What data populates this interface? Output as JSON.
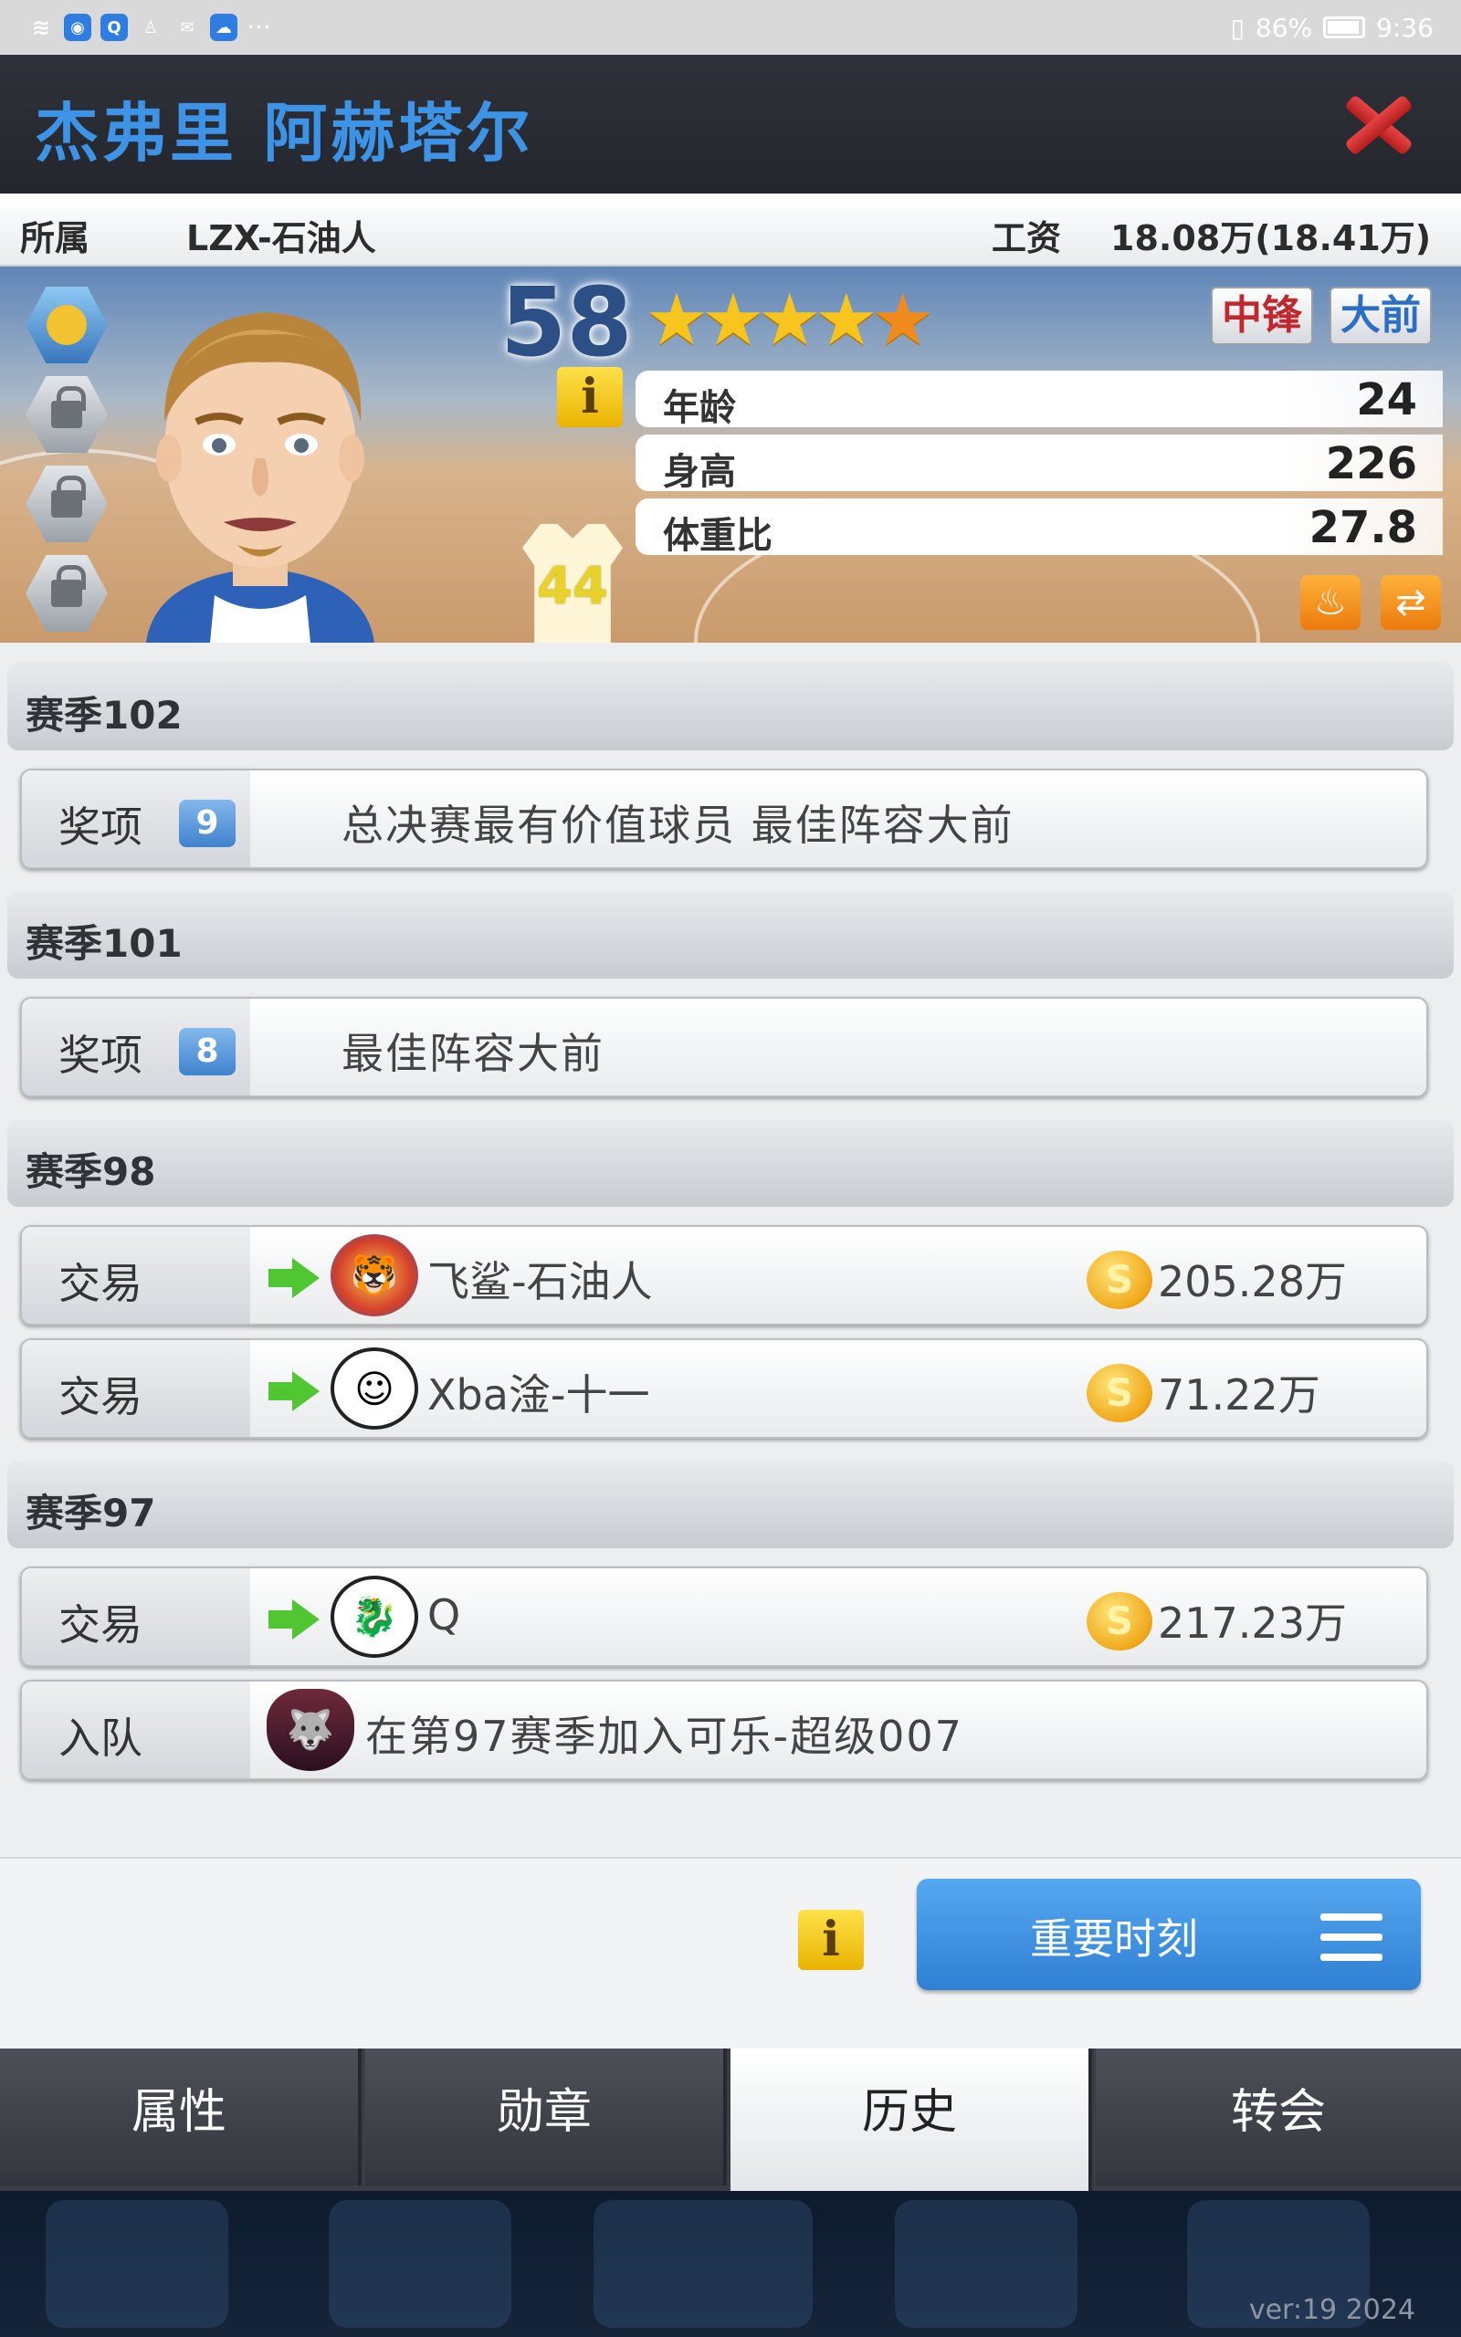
{
  "status_bar": {
    "icons": [
      "wifi-icon",
      "browser-icon",
      "search-app-icon",
      "qq-icon",
      "message-icon",
      "cloud-icon"
    ],
    "more": "···",
    "battery": "86%",
    "time": "9:36"
  },
  "header": {
    "title": "杰弗里 阿赫塔尔"
  },
  "info_strip": {
    "team_label": "所属",
    "team_value": "LZX-石油人",
    "salary_label": "工资",
    "salary_value": "18.08万(18.41万)"
  },
  "player": {
    "rating": "58",
    "stars_full": 4,
    "stars_half": 1,
    "positions": [
      "中锋",
      "大前"
    ],
    "jersey_number": "44",
    "stats": [
      {
        "label": "年龄",
        "value": "24"
      },
      {
        "label": "身高",
        "value": "226"
      },
      {
        "label": "体重比",
        "value": "27.8"
      }
    ],
    "info_button": "i"
  },
  "history": [
    {
      "season": "赛季102",
      "events": [
        {
          "type": "奖项",
          "count": "9",
          "desc": "总决赛最有价值球员  最佳阵容大前"
        }
      ]
    },
    {
      "season": "赛季101",
      "events": [
        {
          "type": "奖项",
          "count": "8",
          "desc": "最佳阵容大前"
        }
      ]
    },
    {
      "season": "赛季98",
      "events": [
        {
          "type": "交易",
          "team": "飞鲨-石油人",
          "price": "205.28万",
          "logo": "tiger-shield-logo"
        },
        {
          "type": "交易",
          "team": "Xba淦-十一",
          "price": "71.22万",
          "logo": "pumpkin-logo"
        }
      ]
    },
    {
      "season": "赛季97",
      "events": [
        {
          "type": "交易",
          "team": "Q",
          "price": "217.23万",
          "logo": "dragon-logo"
        },
        {
          "type": "入队",
          "desc": "在第97赛季加入可乐-超级007",
          "logo": "wolf-shield-logo"
        }
      ]
    }
  ],
  "actions": {
    "info": "i",
    "moments_button": "重要时刻"
  },
  "tabs": [
    "属性",
    "勋章",
    "历史",
    "转会"
  ],
  "active_tab": "历史",
  "version": "ver:19  2024",
  "colors": {
    "accent": "#3d93e6",
    "close": "#d62f2f",
    "button_blue": "#3f8fe0"
  }
}
